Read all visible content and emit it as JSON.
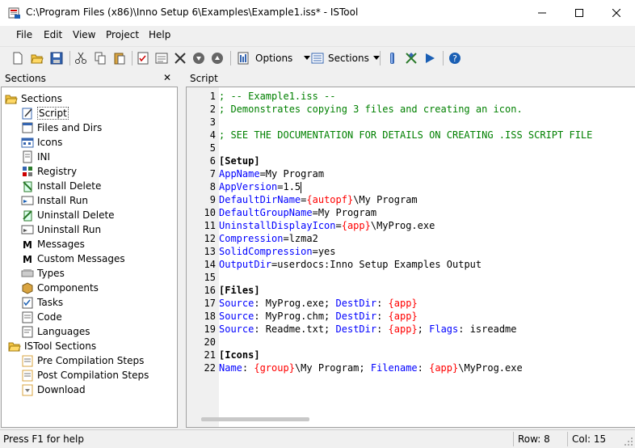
{
  "window": {
    "title": "C:\\Program Files (x86)\\Inno Setup 6\\Examples\\Example1.iss* - ISTool"
  },
  "menu": [
    "File",
    "Edit",
    "View",
    "Project",
    "Help"
  ],
  "toolbar": {
    "options_label": "Options",
    "sections_label": "Sections"
  },
  "sections_panel": {
    "title": "Sections",
    "close": "✕",
    "items": [
      {
        "label": "Sections",
        "icon": "folder-open-icon"
      },
      {
        "label": "Script",
        "icon": "script-icon"
      },
      {
        "label": "Files and Dirs",
        "icon": "files-icon"
      },
      {
        "label": "Icons",
        "icon": "icons-icon"
      },
      {
        "label": "INI",
        "icon": "ini-icon"
      },
      {
        "label": "Registry",
        "icon": "registry-icon"
      },
      {
        "label": "Install Delete",
        "icon": "install-delete-icon"
      },
      {
        "label": "Install Run",
        "icon": "install-run-icon"
      },
      {
        "label": "Uninstall Delete",
        "icon": "uninstall-delete-icon"
      },
      {
        "label": "Uninstall Run",
        "icon": "uninstall-run-icon"
      },
      {
        "label": "Messages",
        "icon": "messages-icon"
      },
      {
        "label": "Custom Messages",
        "icon": "custom-messages-icon"
      },
      {
        "label": "Types",
        "icon": "types-icon"
      },
      {
        "label": "Components",
        "icon": "components-icon"
      },
      {
        "label": "Tasks",
        "icon": "tasks-icon"
      },
      {
        "label": "Code",
        "icon": "code-icon"
      },
      {
        "label": "Languages",
        "icon": "languages-icon"
      },
      {
        "label": "ISTool Sections",
        "icon": "folder-open-icon"
      },
      {
        "label": "Pre Compilation Steps",
        "icon": "pre-compile-icon"
      },
      {
        "label": "Post Compilation Steps",
        "icon": "post-compile-icon"
      },
      {
        "label": "Download",
        "icon": "download-icon"
      }
    ]
  },
  "script_panel": {
    "title": "Script",
    "lines": [
      {
        "n": "1",
        "segs": [
          {
            "t": "; -- Example1.iss --",
            "c": "comment"
          }
        ]
      },
      {
        "n": "2",
        "segs": [
          {
            "t": "; Demonstrates copying 3 files and creating an icon.",
            "c": "comment"
          }
        ]
      },
      {
        "n": "3",
        "segs": []
      },
      {
        "n": "4",
        "segs": [
          {
            "t": "; SEE THE DOCUMENTATION FOR DETAILS ON CREATING .ISS SCRIPT FILE",
            "c": "comment"
          }
        ]
      },
      {
        "n": "5",
        "segs": []
      },
      {
        "n": "6",
        "segs": [
          {
            "t": "[Setup]",
            "c": "section"
          }
        ]
      },
      {
        "n": "7",
        "segs": [
          {
            "t": "AppName",
            "c": "key"
          },
          {
            "t": "=My Program",
            "c": "plain"
          }
        ]
      },
      {
        "n": "8",
        "segs": [
          {
            "t": "AppVersion",
            "c": "key"
          },
          {
            "t": "=1.5",
            "c": "plain"
          }
        ]
      },
      {
        "n": "9",
        "segs": [
          {
            "t": "DefaultDirName",
            "c": "key"
          },
          {
            "t": "=",
            "c": "plain"
          },
          {
            "t": "{autopf}",
            "c": "const"
          },
          {
            "t": "\\My Program",
            "c": "plain"
          }
        ]
      },
      {
        "n": "10",
        "segs": [
          {
            "t": "DefaultGroupName",
            "c": "key"
          },
          {
            "t": "=My Program",
            "c": "plain"
          }
        ]
      },
      {
        "n": "11",
        "segs": [
          {
            "t": "UninstallDisplayIcon",
            "c": "key"
          },
          {
            "t": "=",
            "c": "plain"
          },
          {
            "t": "{app}",
            "c": "const"
          },
          {
            "t": "\\MyProg.exe",
            "c": "plain"
          }
        ]
      },
      {
        "n": "12",
        "segs": [
          {
            "t": "Compression",
            "c": "key"
          },
          {
            "t": "=lzma2",
            "c": "plain"
          }
        ]
      },
      {
        "n": "13",
        "segs": [
          {
            "t": "SolidCompression",
            "c": "key"
          },
          {
            "t": "=yes",
            "c": "plain"
          }
        ]
      },
      {
        "n": "14",
        "segs": [
          {
            "t": "OutputDir",
            "c": "key"
          },
          {
            "t": "=userdocs:Inno Setup Examples Output",
            "c": "plain"
          }
        ]
      },
      {
        "n": "15",
        "segs": []
      },
      {
        "n": "16",
        "segs": [
          {
            "t": "[Files]",
            "c": "section"
          }
        ]
      },
      {
        "n": "17",
        "segs": [
          {
            "t": "Source",
            "c": "key"
          },
          {
            "t": ": MyProg.exe; ",
            "c": "plain"
          },
          {
            "t": "DestDir",
            "c": "key"
          },
          {
            "t": ": ",
            "c": "plain"
          },
          {
            "t": "{app}",
            "c": "const"
          }
        ]
      },
      {
        "n": "18",
        "segs": [
          {
            "t": "Source",
            "c": "key"
          },
          {
            "t": ": MyProg.chm; ",
            "c": "plain"
          },
          {
            "t": "DestDir",
            "c": "key"
          },
          {
            "t": ": ",
            "c": "plain"
          },
          {
            "t": "{app}",
            "c": "const"
          }
        ]
      },
      {
        "n": "19",
        "segs": [
          {
            "t": "Source",
            "c": "key"
          },
          {
            "t": ": Readme.txt; ",
            "c": "plain"
          },
          {
            "t": "DestDir",
            "c": "key"
          },
          {
            "t": ": ",
            "c": "plain"
          },
          {
            "t": "{app}",
            "c": "const"
          },
          {
            "t": "; ",
            "c": "plain"
          },
          {
            "t": "Flags",
            "c": "key"
          },
          {
            "t": ": isreadme",
            "c": "plain"
          }
        ]
      },
      {
        "n": "20",
        "segs": []
      },
      {
        "n": "21",
        "segs": [
          {
            "t": "[Icons]",
            "c": "section"
          }
        ]
      },
      {
        "n": "22",
        "segs": [
          {
            "t": "Name",
            "c": "key"
          },
          {
            "t": ": ",
            "c": "plain"
          },
          {
            "t": "{group}",
            "c": "const"
          },
          {
            "t": "\\My Program; ",
            "c": "plain"
          },
          {
            "t": "Filename",
            "c": "key"
          },
          {
            "t": ": ",
            "c": "plain"
          },
          {
            "t": "{app}",
            "c": "const"
          },
          {
            "t": "\\MyProg.exe",
            "c": "plain"
          }
        ]
      }
    ]
  },
  "colors": {
    "comment": "#008000",
    "key": "#0000ff",
    "const": "#ff0000",
    "plain": "#000000",
    "section": "#000000",
    "selection": "#0078d7"
  },
  "status": {
    "help": "Press F1 for help",
    "row": "Row: 8",
    "col": "Col: 15"
  }
}
